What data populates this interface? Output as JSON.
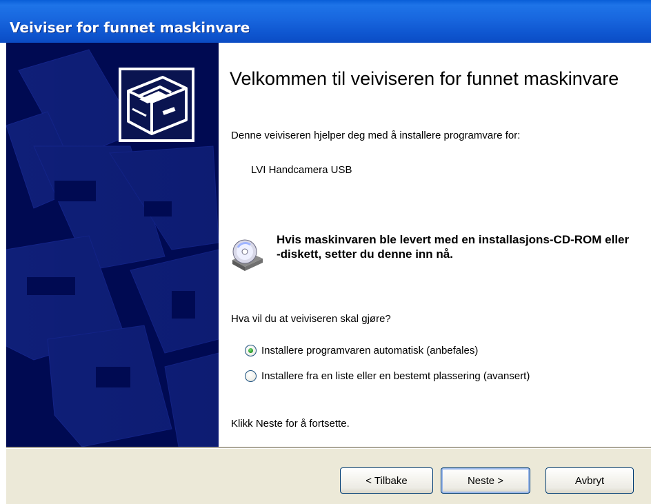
{
  "window": {
    "title": "Veiviser for funnet maskinvare"
  },
  "side_panel": {
    "icon": "hardware-drawer-icon"
  },
  "content": {
    "heading": "Velkommen til veiviseren for funnet maskinvare",
    "intro": "Denne veiviseren hjelper deg med å installere programvare for:",
    "device_name": "LVI Handcamera USB",
    "cd_icon": "cd-drive-icon",
    "cd_note": "Hvis maskinvaren ble levert med en installasjons-CD-ROM eller -diskett, setter du denne inn nå.",
    "question": "Hva vil du at veiviseren skal gjøre?",
    "options": [
      {
        "label": "Installere programvaren automatisk (anbefales)",
        "selected": true
      },
      {
        "label": "Installere fra en liste eller en bestemt plassering (avansert)",
        "selected": false
      }
    ],
    "footer_note": "Klikk Neste for å fortsette."
  },
  "buttons": {
    "back": "< Tilbake",
    "next": "Neste >",
    "cancel": "Avbryt"
  },
  "colors": {
    "title_bar": "#0b58d4",
    "side_panel": "#000a52",
    "button_bar": "#ece9d8",
    "radio_selected": "#2f9c2f"
  }
}
